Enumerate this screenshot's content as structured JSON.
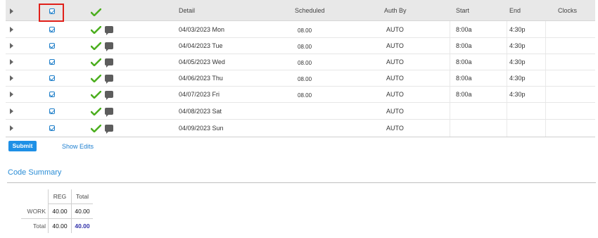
{
  "header": {
    "detail": "Detail",
    "scheduled": "Scheduled",
    "auth_by": "Auth By",
    "start": "Start",
    "end": "End",
    "clocks": "Clocks"
  },
  "rows": [
    {
      "date": "04/03/2023 Mon",
      "scheduled": "08.00",
      "auth": "AUTO",
      "start": "8:00a",
      "end": "4:30p"
    },
    {
      "date": "04/04/2023 Tue",
      "scheduled": "08.00",
      "auth": "AUTO",
      "start": "8:00a",
      "end": "4:30p"
    },
    {
      "date": "04/05/2023 Wed",
      "scheduled": "08.00",
      "auth": "AUTO",
      "start": "8:00a",
      "end": "4:30p"
    },
    {
      "date": "04/06/2023 Thu",
      "scheduled": "08.00",
      "auth": "AUTO",
      "start": "8:00a",
      "end": "4:30p"
    },
    {
      "date": "04/07/2023 Fri",
      "scheduled": "08.00",
      "auth": "AUTO",
      "start": "8:00a",
      "end": "4:30p"
    },
    {
      "date": "04/08/2023 Sat",
      "scheduled": "",
      "auth": "AUTO",
      "start": "",
      "end": ""
    },
    {
      "date": "04/09/2023 Sun",
      "scheduled": "",
      "auth": "AUTO",
      "start": "",
      "end": ""
    }
  ],
  "actions": {
    "submit": "Submit",
    "show_edits": "Show Edits"
  },
  "code_summary": {
    "title": "Code Summary",
    "columns": [
      "REG",
      "Total"
    ],
    "rows": [
      {
        "label": "WORK",
        "reg": "40.00",
        "total": "40.00"
      },
      {
        "label": "Total",
        "reg": "40.00",
        "total": "40.00"
      }
    ]
  },
  "colors": {
    "accent": "#1e90e6",
    "check_green": "#4caf1f",
    "highlight_red": "#e0201a"
  }
}
